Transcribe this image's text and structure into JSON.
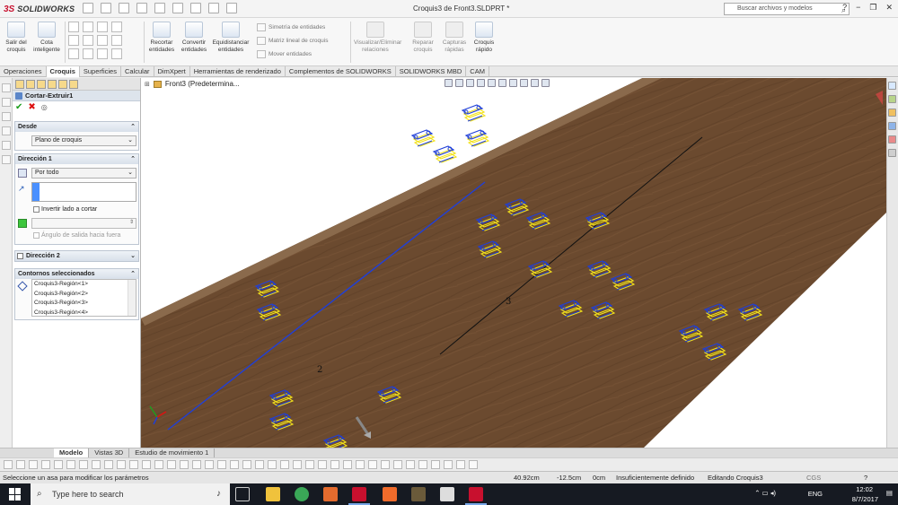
{
  "window": {
    "brand_ds": "3S",
    "brand_name": "SOLIDWORKS",
    "title": "Croquis3 de Front3.SLDPRT *",
    "search_placeholder": "Buscar archivos y modelos",
    "controls": [
      "?",
      "−",
      "❐",
      "✕"
    ]
  },
  "commands": {
    "salir": "Salir del croquis",
    "cota": "Cota inteligente",
    "recortar": "Recortar entidades",
    "convertir": "Convertir entidades",
    "equidistanciar": "Equidistanciar entidades",
    "simetria": "Simetría de entidades",
    "matriz": "Matriz lineal de croquis",
    "mover": "Mover entidades",
    "visualizar": "Visualizar/Eliminar relaciones",
    "reparar": "Reparar croquis",
    "capturas": "Capturas rápidas",
    "croquis_rapido": "Croquis rápido"
  },
  "tabs": [
    "Operaciones",
    "Croquis",
    "Superficies",
    "Calcular",
    "DimXpert",
    "Herramientas de renderizado",
    "Complementos de SOLIDWORKS",
    "SOLIDWORKS MBD",
    "CAM"
  ],
  "active_tab": "Croquis",
  "property_manager": {
    "feature_title": "Cortar-Extruir1",
    "ok": "✔",
    "cancel": "✖",
    "desde": {
      "title": "Desde",
      "value": "Plano de croquis"
    },
    "direccion1": {
      "title": "Dirección 1",
      "end_condition": "Por todo",
      "invertir": "Invertir lado a cortar",
      "angulo": "Ángulo de salida hacia fuera"
    },
    "direccion2": {
      "title": "Dirección 2"
    },
    "contornos": {
      "title": "Contornos seleccionados",
      "items": [
        "Croquis3-Región<1>",
        "Croquis3-Región<2>",
        "Croquis3-Región<3>",
        "Croquis3-Región<4>"
      ]
    }
  },
  "viewport": {
    "tree_label": "Front3  (Predetermina...",
    "dim_2": "2",
    "dim_3": "3"
  },
  "bottom_tabs": [
    "Modelo",
    "Vistas 3D",
    "Estudio de movimiento 1"
  ],
  "active_bottom_tab": "Modelo",
  "status": {
    "hint": "Seleccione un asa para modificar los parámetros",
    "x": "40.92cm",
    "y": "-12.5cm",
    "z": "0cm",
    "defined": "Insuficientemente definido",
    "editing": "Editando Croquis3",
    "units": "CGS",
    "help": "?"
  },
  "taskbar": {
    "search_placeholder": "Type here to search",
    "lang": "ENG",
    "time": "12:02",
    "date": "8/7/2017"
  },
  "colors": {
    "wood": "#6b4a2f",
    "accent_blue": "#1f3fd8",
    "profile_yellow": "#f2e21c",
    "taskbar": "#161a22"
  }
}
